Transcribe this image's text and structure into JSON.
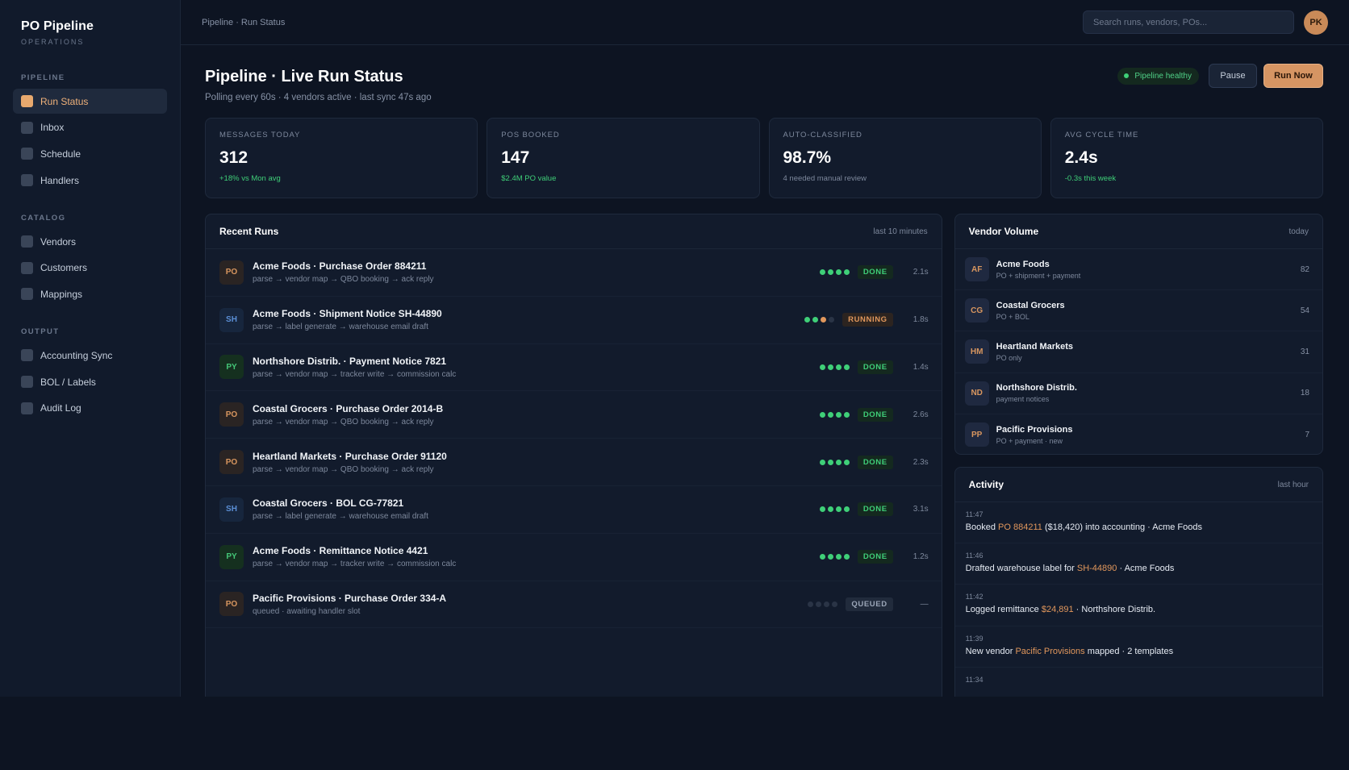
{
  "brand": {
    "title": "PO Pipeline",
    "subtitle": "OPERATIONS"
  },
  "sidebar": {
    "sections": [
      {
        "title": "PIPELINE",
        "items": [
          {
            "label": "Run Status",
            "active": true
          },
          {
            "label": "Inbox"
          },
          {
            "label": "Schedule"
          },
          {
            "label": "Handlers"
          }
        ]
      },
      {
        "title": "CATALOG",
        "items": [
          {
            "label": "Vendors"
          },
          {
            "label": "Customers"
          },
          {
            "label": "Mappings"
          }
        ]
      },
      {
        "title": "OUTPUT",
        "items": [
          {
            "label": "Accounting Sync"
          },
          {
            "label": "BOL / Labels"
          },
          {
            "label": "Audit Log"
          }
        ]
      }
    ]
  },
  "topbar": {
    "breadcrumb": "Pipeline · Run Status",
    "search_placeholder": "Search runs, vendors, POs...",
    "avatar_initials": "PK"
  },
  "header": {
    "title": "Pipeline · Live Run Status",
    "subtitle": "Polling every 60s · 4 vendors active · last sync 47s ago",
    "health_label": "Pipeline healthy",
    "pause_label": "Pause",
    "run_label": "Run Now"
  },
  "stats": [
    {
      "label": "MESSAGES TODAY",
      "value": "312",
      "note": "+18% vs Mon avg",
      "tone": "green"
    },
    {
      "label": "POS BOOKED",
      "value": "147",
      "note": "$2.4M PO value",
      "tone": "green"
    },
    {
      "label": "AUTO-CLASSIFIED",
      "value": "98.7%",
      "note": "4 needed manual review",
      "tone": "muted"
    },
    {
      "label": "AVG CYCLE TIME",
      "value": "2.4s",
      "note": "-0.3s this week",
      "tone": "green"
    }
  ],
  "runs": {
    "title": "Recent Runs",
    "meta": "last 10 minutes",
    "rows": [
      {
        "badge": "PO",
        "kind": "po",
        "title": "Acme Foods · Purchase Order 884211",
        "steps": "parse → vendor map → QBO booking → ack reply",
        "progress": [
          1,
          1,
          1,
          1
        ],
        "status": "DONE",
        "time": "2.1s"
      },
      {
        "badge": "SH",
        "kind": "sh",
        "title": "Acme Foods · Shipment Notice SH-44890",
        "steps": "parse → label generate → warehouse email draft",
        "progress": [
          1,
          1,
          2,
          0
        ],
        "status": "RUNNING",
        "time": "1.8s"
      },
      {
        "badge": "PY",
        "kind": "py",
        "title": "Northshore Distrib. · Payment Notice 7821",
        "steps": "parse → vendor map → tracker write → commission calc",
        "progress": [
          1,
          1,
          1,
          1
        ],
        "status": "DONE",
        "time": "1.4s"
      },
      {
        "badge": "PO",
        "kind": "po",
        "title": "Coastal Grocers · Purchase Order 2014-B",
        "steps": "parse → vendor map → QBO booking → ack reply",
        "progress": [
          1,
          1,
          1,
          1
        ],
        "status": "DONE",
        "time": "2.6s"
      },
      {
        "badge": "PO",
        "kind": "po",
        "title": "Heartland Markets · Purchase Order 91120",
        "steps": "parse → vendor map → QBO booking → ack reply",
        "progress": [
          1,
          1,
          1,
          1
        ],
        "status": "DONE",
        "time": "2.3s"
      },
      {
        "badge": "SH",
        "kind": "sh",
        "title": "Coastal Grocers · BOL CG-77821",
        "steps": "parse → label generate → warehouse email draft",
        "progress": [
          1,
          1,
          1,
          1
        ],
        "status": "DONE",
        "time": "3.1s"
      },
      {
        "badge": "PY",
        "kind": "py",
        "title": "Acme Foods · Remittance Notice 4421",
        "steps": "parse → vendor map → tracker write → commission calc",
        "progress": [
          1,
          1,
          1,
          1
        ],
        "status": "DONE",
        "time": "1.2s"
      },
      {
        "badge": "PO",
        "kind": "po",
        "title": "Pacific Provisions · Purchase Order 334-A",
        "steps": "queued · awaiting handler slot",
        "progress": [
          0,
          0,
          0,
          0
        ],
        "status": "QUEUED",
        "time": "—"
      }
    ]
  },
  "vendors": {
    "title": "Vendor Volume",
    "meta": "today",
    "rows": [
      {
        "initials": "AF",
        "name": "Acme Foods",
        "sub": "PO + shipment + payment",
        "count": "82"
      },
      {
        "initials": "CG",
        "name": "Coastal Grocers",
        "sub": "PO + BOL",
        "count": "54"
      },
      {
        "initials": "HM",
        "name": "Heartland Markets",
        "sub": "PO only",
        "count": "31"
      },
      {
        "initials": "ND",
        "name": "Northshore Distrib.",
        "sub": "payment notices",
        "count": "18"
      },
      {
        "initials": "PP",
        "name": "Pacific Provisions",
        "sub": "PO + payment · new",
        "count": "7"
      }
    ]
  },
  "activity": {
    "title": "Activity",
    "meta": "last hour",
    "items": [
      {
        "time": "11:47",
        "parts": [
          [
            "Booked ",
            false
          ],
          [
            "PO 884211",
            true
          ],
          [
            " ($18,420) into accounting · Acme Foods",
            false
          ]
        ]
      },
      {
        "time": "11:46",
        "parts": [
          [
            "Drafted warehouse label for ",
            false
          ],
          [
            "SH-44890",
            true
          ],
          [
            " · Acme Foods",
            false
          ]
        ]
      },
      {
        "time": "11:42",
        "parts": [
          [
            "Logged remittance ",
            false
          ],
          [
            "$24,891",
            true
          ],
          [
            " · Northshore Distrib.",
            false
          ]
        ]
      },
      {
        "time": "11:39",
        "parts": [
          [
            "New vendor ",
            false
          ],
          [
            "Pacific Provisions",
            true
          ],
          [
            " mapped · 2 templates",
            false
          ]
        ]
      },
      {
        "time": "11:34",
        "parts": []
      }
    ]
  },
  "colors": {
    "accent": "#d69563",
    "success": "#3fcf78",
    "background": "#0d1422",
    "panel": "#121b2c"
  }
}
